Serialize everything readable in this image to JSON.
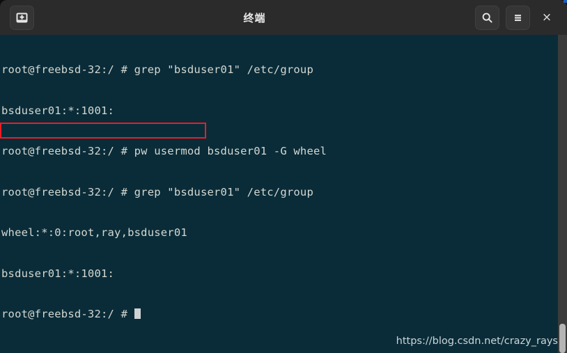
{
  "window": {
    "title": "终端",
    "bg_color": "#0a2c39",
    "titlebar_color": "#2b2b2b"
  },
  "titlebar": {
    "new_tab_label": "new-terminal",
    "search_label": "search",
    "menu_label": "menu",
    "close_label": "×"
  },
  "terminal": {
    "text_color": "#d4d8d1",
    "lines": [
      "root@freebsd-32:/ # grep \"bsduser01\" /etc/group",
      "bsduser01:*:1001:",
      "root@freebsd-32:/ # pw usermod bsduser01 -G wheel",
      "root@freebsd-32:/ # grep \"bsduser01\" /etc/group",
      "wheel:*:0:root,ray,bsduser01",
      "bsduser01:*:1001:",
      "root@freebsd-32:/ # "
    ],
    "prompt": "root@freebsd-32:/ #",
    "cursor_visible": true
  },
  "annotation": {
    "highlight_color": "#ed1c24",
    "highlighted_line": "wheel:*:0:root,ray,bsduser01"
  },
  "watermark": {
    "text": "https://blog.csdn.net/crazy_rays"
  },
  "scrollbar": {
    "track_color": "#3b3b3b",
    "thumb_color": "#b4b4b4"
  }
}
